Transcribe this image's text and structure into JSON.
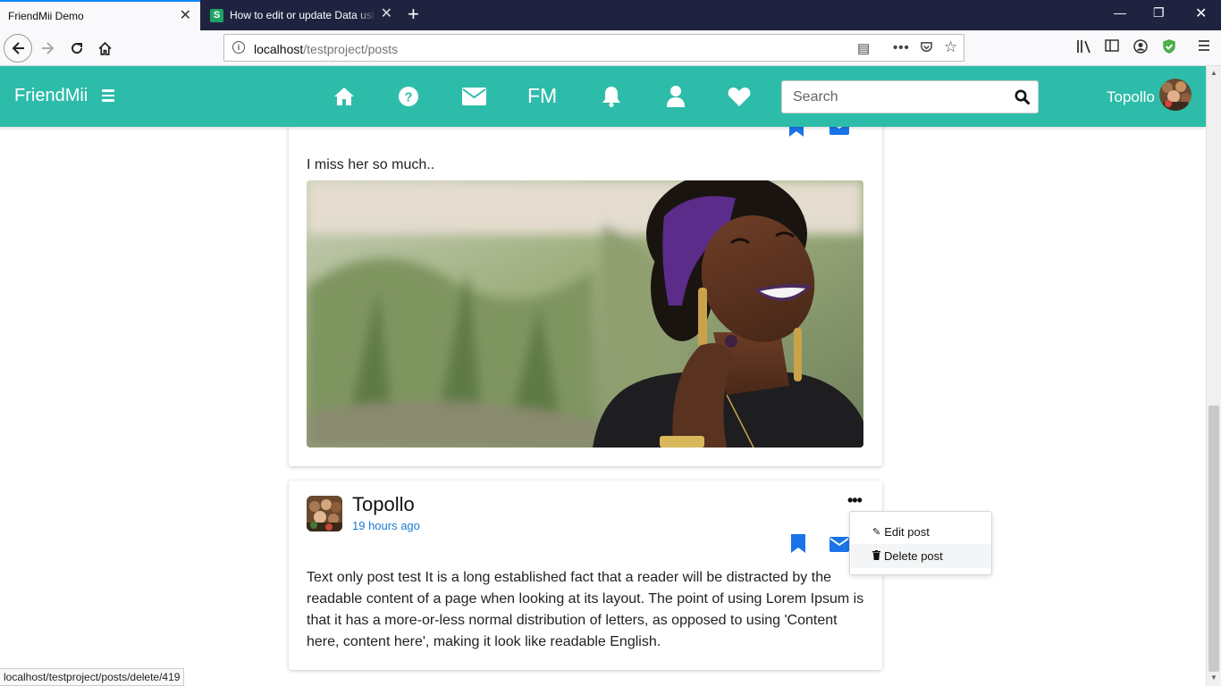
{
  "browser": {
    "tabs": [
      {
        "title": "FriendMii Demo",
        "active": true
      },
      {
        "title": "How to edit or update Data usi",
        "favicon": "S",
        "active": false
      }
    ],
    "url_host": "localhost",
    "url_path": "/testproject/posts",
    "status_url": "localhost/testproject/posts/delete/419"
  },
  "header": {
    "brand": "FriendMii",
    "fm_label": "FM",
    "search_placeholder": "Search",
    "user_name": "Topollo",
    "nav_icons": [
      "home-icon",
      "help-icon",
      "envelope-icon",
      "fm",
      "bell-icon",
      "user-icon",
      "heart-icon"
    ],
    "accent_color": "#2ebcaa"
  },
  "posts": [
    {
      "text": "I miss her so much..",
      "image": "photo of smiling woman with purple headscarf"
    },
    {
      "author": "Topollo",
      "time": "19 hours ago",
      "text": "Text only post test It is a long established fact that a reader will be distracted by the readable content of a page when looking at its layout. The point of using Lorem Ipsum is that it has a more-or-less normal distribution of letters, as opposed to using 'Content here, content here', making it look like readable English.",
      "more": "•••"
    }
  ],
  "dropdown": {
    "items": [
      {
        "label": "Edit post",
        "icon": "pencil-icon"
      },
      {
        "label": "Delete post",
        "icon": "trash-icon"
      }
    ]
  },
  "colors": {
    "link_blue": "#1a7ad0",
    "icon_blue": "#1a73e8"
  }
}
